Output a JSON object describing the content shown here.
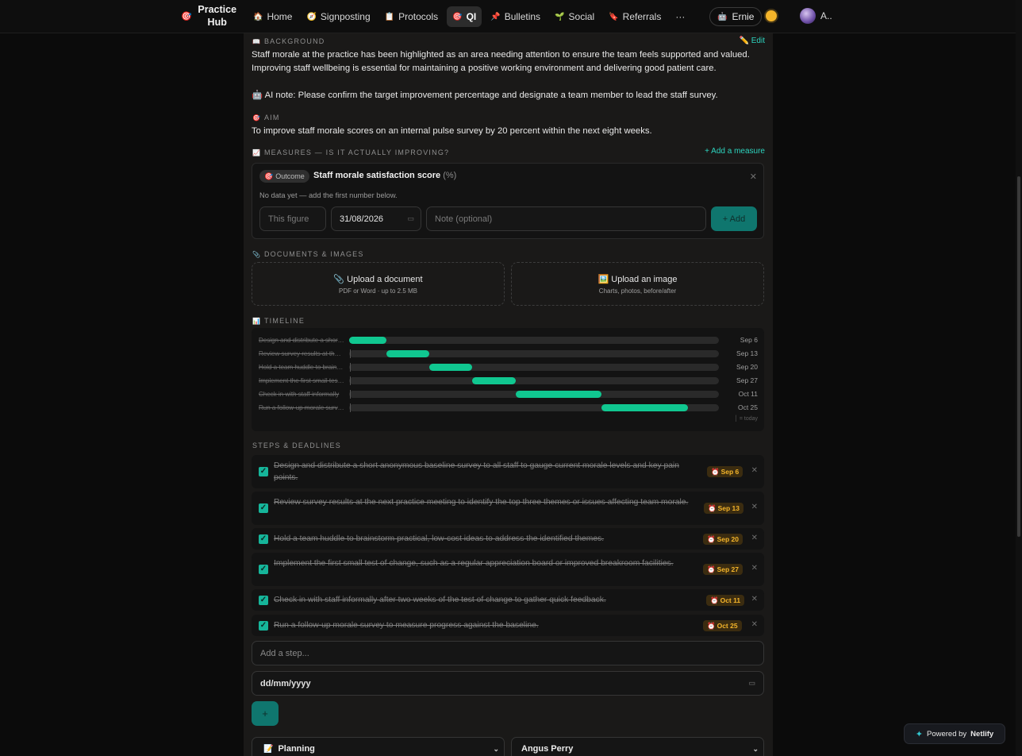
{
  "nav": {
    "brand_line1": "Practice",
    "brand_line2": "Hub",
    "brand_icon": "target-icon",
    "links": [
      {
        "label": "Home",
        "icon": "house-icon"
      },
      {
        "label": "Signposting",
        "icon": "compass-icon"
      },
      {
        "label": "Protocols",
        "icon": "clipboard-icon"
      },
      {
        "label": "QI",
        "icon": "target-icon",
        "active": true
      },
      {
        "label": "Bulletins",
        "icon": "pushpin-icon"
      },
      {
        "label": "Social",
        "icon": "seedling-icon"
      },
      {
        "label": "Referrals",
        "icon": "bookmark-icon"
      },
      {
        "label": "···",
        "icon": ""
      }
    ],
    "user_label": "Ernie",
    "avatar_label": "A..",
    "theme_icon": "sun-icon"
  },
  "background": {
    "label": "BACKGROUND",
    "edit_label": "Edit",
    "text": "Staff morale at the practice has been highlighted as an area needing attention to ensure the team feels supported and valued. Improving staff wellbeing is essential for maintaining a positive working environment and delivering good patient care.",
    "ai_note": "AI note: Please confirm the target improvement percentage and designate a team member to lead the staff survey."
  },
  "aim": {
    "label": "AIM",
    "text": "To improve staff morale scores on an internal pulse survey by 20 percent within the next eight weeks."
  },
  "measures": {
    "label": "MEASURES — IS IT ACTUALLY IMPROVING?",
    "add_label": "+ Add a measure",
    "item": {
      "tag": "Outcome",
      "title": "Staff morale satisfaction score",
      "unit": "(%)",
      "empty": "No data yet — add the first number below.",
      "figure_placeholder": "This figure",
      "date_value": "31/08/2026",
      "note_placeholder": "Note (optional)",
      "add_button": "+ Add"
    }
  },
  "documents": {
    "label": "DOCUMENTS & IMAGES",
    "doc_title": "Upload a document",
    "doc_sub": "PDF or Word · up to 2.5 MB",
    "img_title": "Upload an image",
    "img_sub": "Charts, photos, before/after"
  },
  "timeline": {
    "label": "TIMELINE",
    "legend": "│ = today",
    "start_date": "2026-08-31",
    "end_date": "2026-10-30",
    "rows": [
      {
        "label": "Design and distribute a short anonymous baseline survey to all staff",
        "date": "Sep 6",
        "start": "2026-08-31",
        "end": "2026-09-06"
      },
      {
        "label": "Review survey results at the next practice meeting",
        "date": "Sep 13",
        "start": "2026-09-06",
        "end": "2026-09-13"
      },
      {
        "label": "Hold a team huddle to brainstorm practical ideas",
        "date": "Sep 20",
        "start": "2026-09-13",
        "end": "2026-09-20"
      },
      {
        "label": "Implement the first small test of change",
        "date": "Sep 27",
        "start": "2026-09-20",
        "end": "2026-09-27"
      },
      {
        "label": "Check in with staff informally",
        "date": "Oct 11",
        "start": "2026-09-27",
        "end": "2026-10-11"
      },
      {
        "label": "Run a follow-up morale survey",
        "date": "Oct 25",
        "start": "2026-10-11",
        "end": "2026-10-25"
      }
    ]
  },
  "steps": {
    "label": "STEPS & DEADLINES",
    "items": [
      {
        "text": "Design and distribute a short anonymous baseline survey to all staff to gauge current morale levels and key pain points.",
        "due": "Sep 6",
        "done": true
      },
      {
        "text": "Review survey results at the next practice meeting to identify the top three themes or issues affecting team morale.",
        "due": "Sep 13",
        "done": true
      },
      {
        "text": "Hold a team huddle to brainstorm practical, low-cost ideas to address the identified themes.",
        "due": "Sep 20",
        "done": true
      },
      {
        "text": "Implement the first small test of change, such as a regular appreciation board or improved breakroom facilities.",
        "due": "Sep 27",
        "done": true
      },
      {
        "text": "Check in with staff informally after two weeks of the test of change to gather quick feedback.",
        "due": "Oct 11",
        "done": true
      },
      {
        "text": "Run a follow-up morale survey to measure progress against the baseline.",
        "due": "Oct 25",
        "done": true
      }
    ],
    "add_placeholder": "Add a step...",
    "date_placeholder": "dd/mm/yyyy",
    "add_button": "+"
  },
  "footer": {
    "status_select": "Planning",
    "owner_select": "Angus Perry"
  },
  "netlify": {
    "prefix": "Powered by",
    "brand": "Netlify"
  },
  "colors": {
    "accent": "#2dd4bf",
    "bar": "#10c790",
    "due_badge": "#f5b52a",
    "button": "#0f766e"
  }
}
